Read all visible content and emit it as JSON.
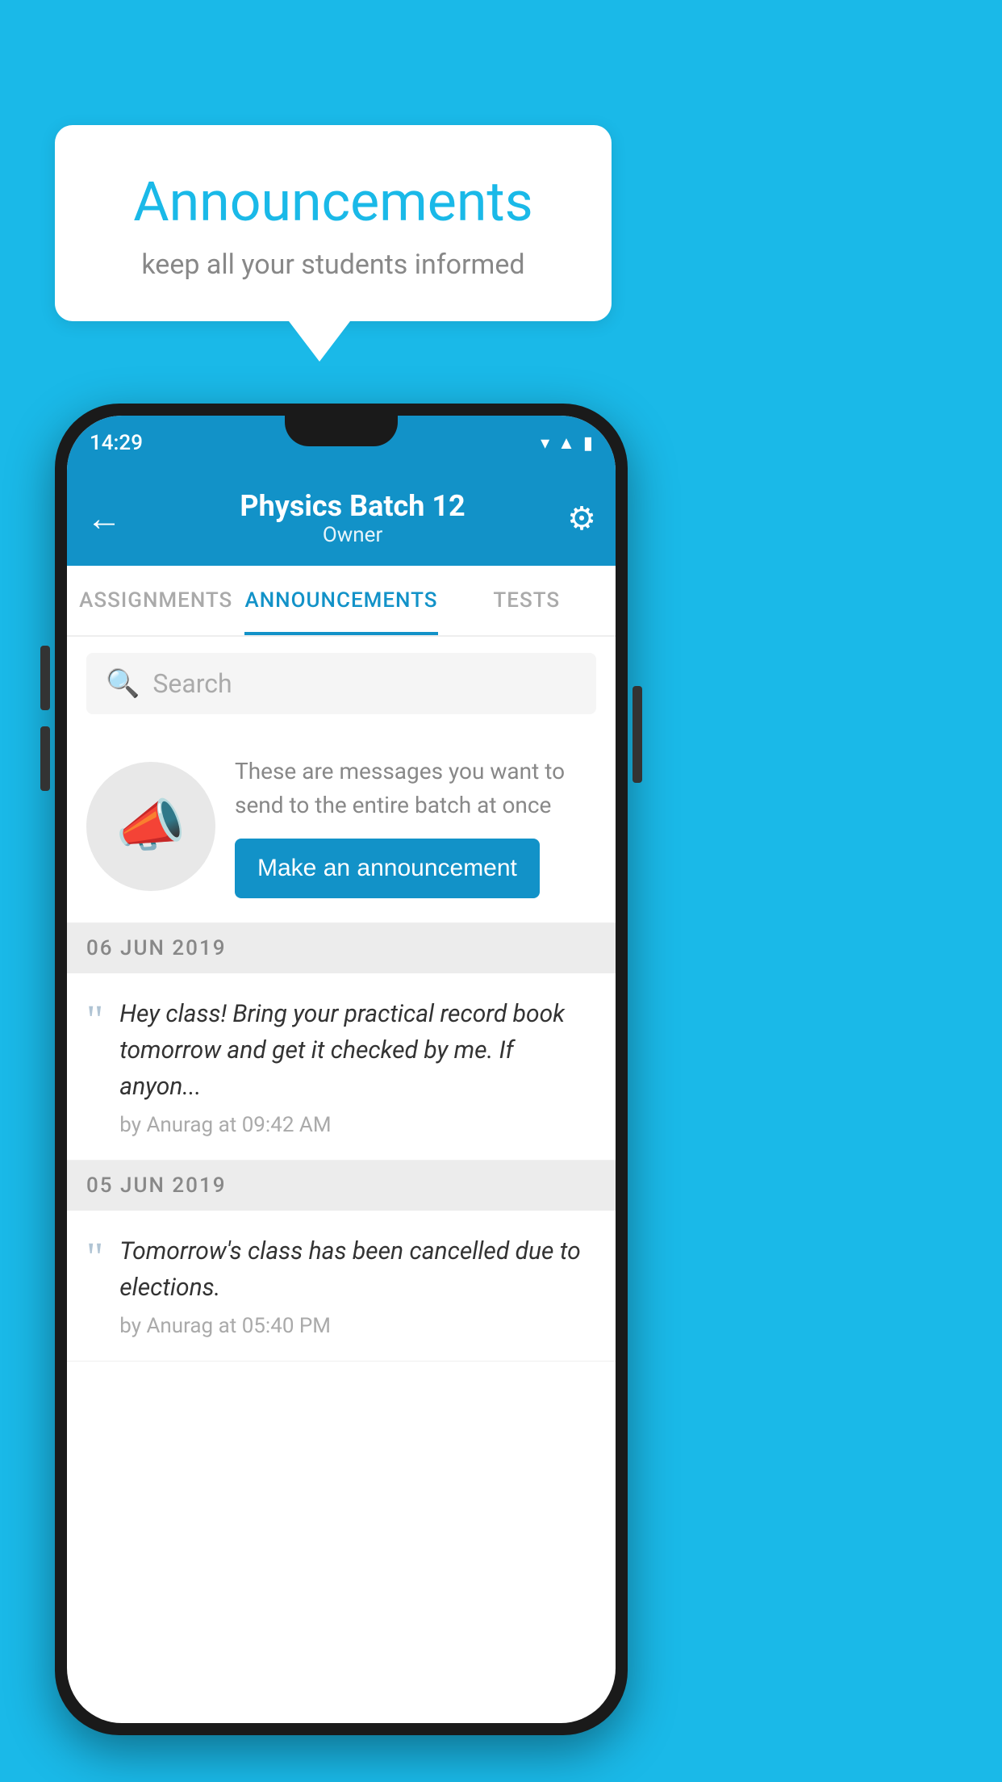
{
  "background_color": "#1ab9e8",
  "speech_bubble": {
    "title": "Announcements",
    "subtitle": "keep all your students informed"
  },
  "status_bar": {
    "time": "14:29"
  },
  "app_bar": {
    "title": "Physics Batch 12",
    "subtitle": "Owner",
    "back_label": "←",
    "settings_label": "⚙"
  },
  "tabs": [
    {
      "label": "ASSIGNMENTS",
      "active": false
    },
    {
      "label": "ANNOUNCEMENTS",
      "active": true
    },
    {
      "label": "TESTS",
      "active": false
    }
  ],
  "search": {
    "placeholder": "Search"
  },
  "promo": {
    "description": "These are messages you want to send to the entire batch at once",
    "button_label": "Make an announcement"
  },
  "announcements": [
    {
      "date": "06  JUN  2019",
      "text": "Hey class! Bring your practical record book tomorrow and get it checked by me. If anyon...",
      "meta": "by Anurag at 09:42 AM"
    },
    {
      "date": "05  JUN  2019",
      "text": "Tomorrow's class has been cancelled due to elections.",
      "meta": "by Anurag at 05:40 PM"
    }
  ]
}
